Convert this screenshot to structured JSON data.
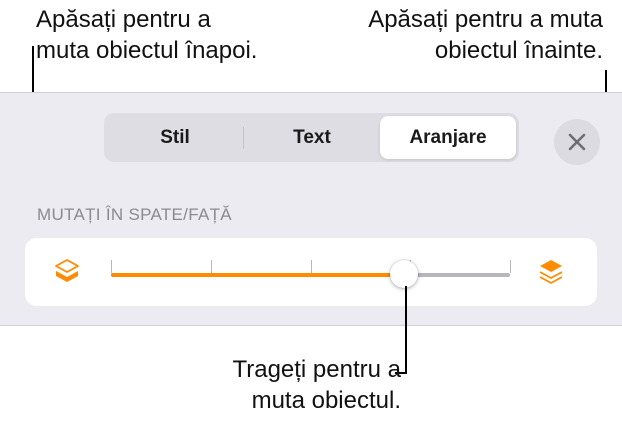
{
  "callouts": {
    "send_backward": [
      "Apăsați pentru a",
      "muta obiectul înapoi."
    ],
    "bring_forward": [
      "Apăsați pentru a muta",
      "obiectul înainte."
    ],
    "drag": [
      "Trageți pentru a",
      "muta obiectul."
    ]
  },
  "tabs": [
    {
      "label": "Stil",
      "active": false
    },
    {
      "label": "Text",
      "active": false
    },
    {
      "label": "Aranjare",
      "active": true
    }
  ],
  "close_icon": "close-x-icon",
  "section_label": "MUTAȚI ÎN SPATE/FAȚĂ",
  "slider": {
    "value_fraction": 0.735,
    "tick_count": 4,
    "accent_color": "#ff8c00",
    "back_icon": "send-backward-layers-icon",
    "front_icon": "bring-forward-layers-icon"
  }
}
